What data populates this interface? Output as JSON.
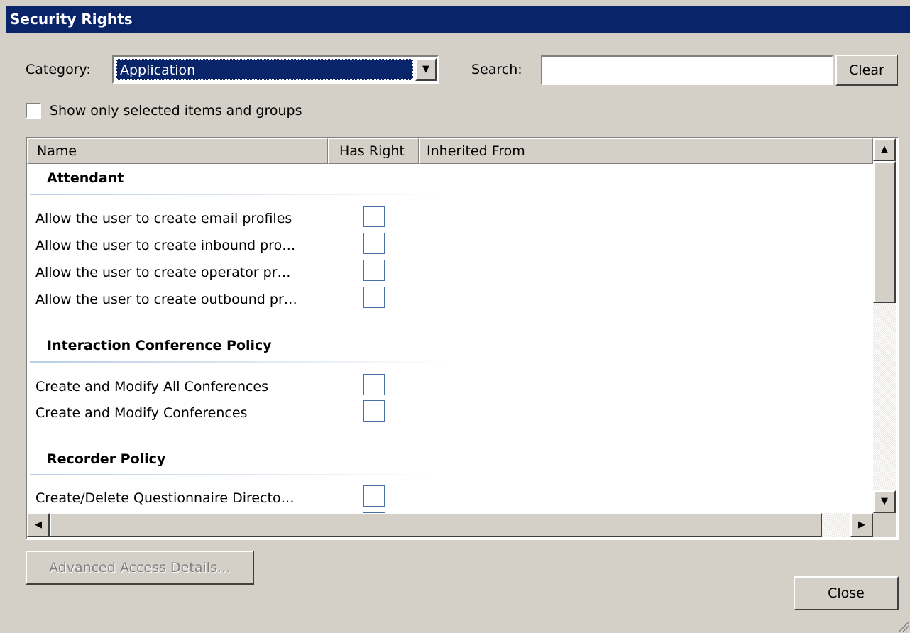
{
  "window": {
    "title": "Security Rights"
  },
  "filter": {
    "category_label": "Category:",
    "category_value": "Application",
    "search_label": "Search:",
    "search_value": "",
    "clear_label": "Clear",
    "show_selected_label": "Show only selected items and groups",
    "show_selected_checked": false
  },
  "list": {
    "columns": [
      "Name",
      "Has Right",
      "Inherited From"
    ],
    "groups": [
      {
        "name": "Attendant",
        "items": [
          {
            "name": "Allow the user to create email profiles",
            "has_right": false
          },
          {
            "name": "Allow the user to create inbound pro…",
            "has_right": false
          },
          {
            "name": "Allow the user to create operator pr…",
            "has_right": false
          },
          {
            "name": "Allow the user to create outbound pr…",
            "has_right": false
          }
        ]
      },
      {
        "name": "Interaction Conference Policy",
        "items": [
          {
            "name": "Create and Modify All Conferences",
            "has_right": false
          },
          {
            "name": "Create and Modify Conferences",
            "has_right": false
          }
        ]
      },
      {
        "name": "Recorder Policy",
        "items": [
          {
            "name": "Create/Delete Questionnaire Directo…",
            "has_right": false
          }
        ]
      }
    ]
  },
  "buttons": {
    "advanced_label": "Advanced Access Details…",
    "close_label": "Close"
  },
  "icons": {
    "dropdown": "chevron-down-icon",
    "scroll_up": "arrow-up-icon",
    "scroll_down": "arrow-down-icon",
    "scroll_left": "arrow-left-icon",
    "scroll_right": "arrow-right-icon",
    "resize": "resize-grip-icon"
  },
  "colors": {
    "titlebar": "#0a246a",
    "selection": "#0a246a",
    "dialog_bg": "#d4d0c8",
    "checkbox_border": "#4a72a8"
  }
}
